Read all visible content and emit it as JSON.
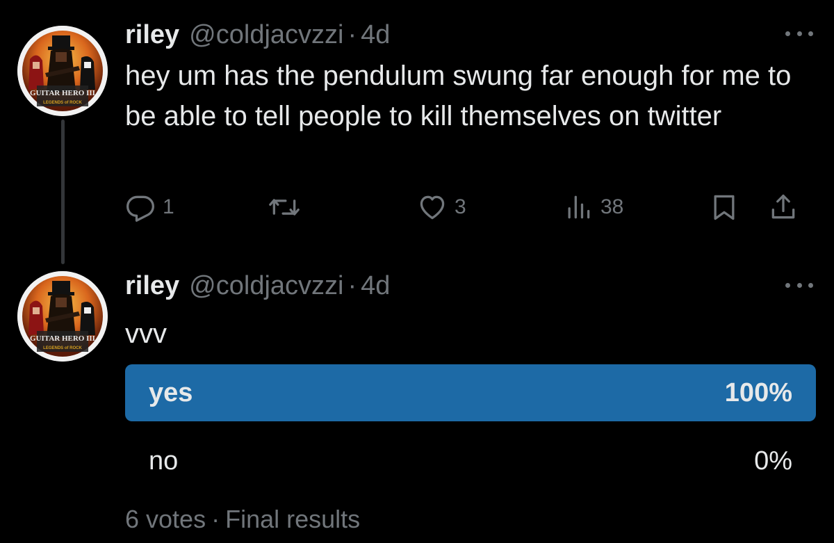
{
  "posts": [
    {
      "display_name": "riley",
      "handle": "@coldjacvzzi",
      "separator": "·",
      "time": "4d",
      "avatar_icon": "guitar-hero-avatar",
      "avatar_logo_text": "GUITAR HERO III",
      "avatar_logo_sub": "LEGENDS of ROCK",
      "text": "hey um has the pendulum swung far enough for me to be able to tell people to kill themselves on twitter",
      "actions": {
        "reply_count": "1",
        "retweet_count": "",
        "like_count": "3",
        "views_count": "38"
      }
    },
    {
      "display_name": "riley",
      "handle": "@coldjacvzzi",
      "separator": "·",
      "time": "4d",
      "avatar_icon": "guitar-hero-avatar",
      "avatar_logo_text": "GUITAR HERO III",
      "avatar_logo_sub": "LEGENDS of ROCK",
      "text": "vvv"
    }
  ],
  "poll": {
    "options": [
      {
        "label": "yes",
        "percent_label": "100%",
        "fraction": 1.0,
        "winner": true
      },
      {
        "label": "no",
        "percent_label": "0%",
        "fraction": 0.0,
        "winner": false
      }
    ],
    "votes": "6 votes",
    "separator": "·",
    "status": "Final results"
  },
  "colors": {
    "background": "#000000",
    "text_primary": "#e7e9ea",
    "text_secondary": "#71767b",
    "poll_winner_fill": "#1d6aa6",
    "thread_line": "#333639"
  }
}
